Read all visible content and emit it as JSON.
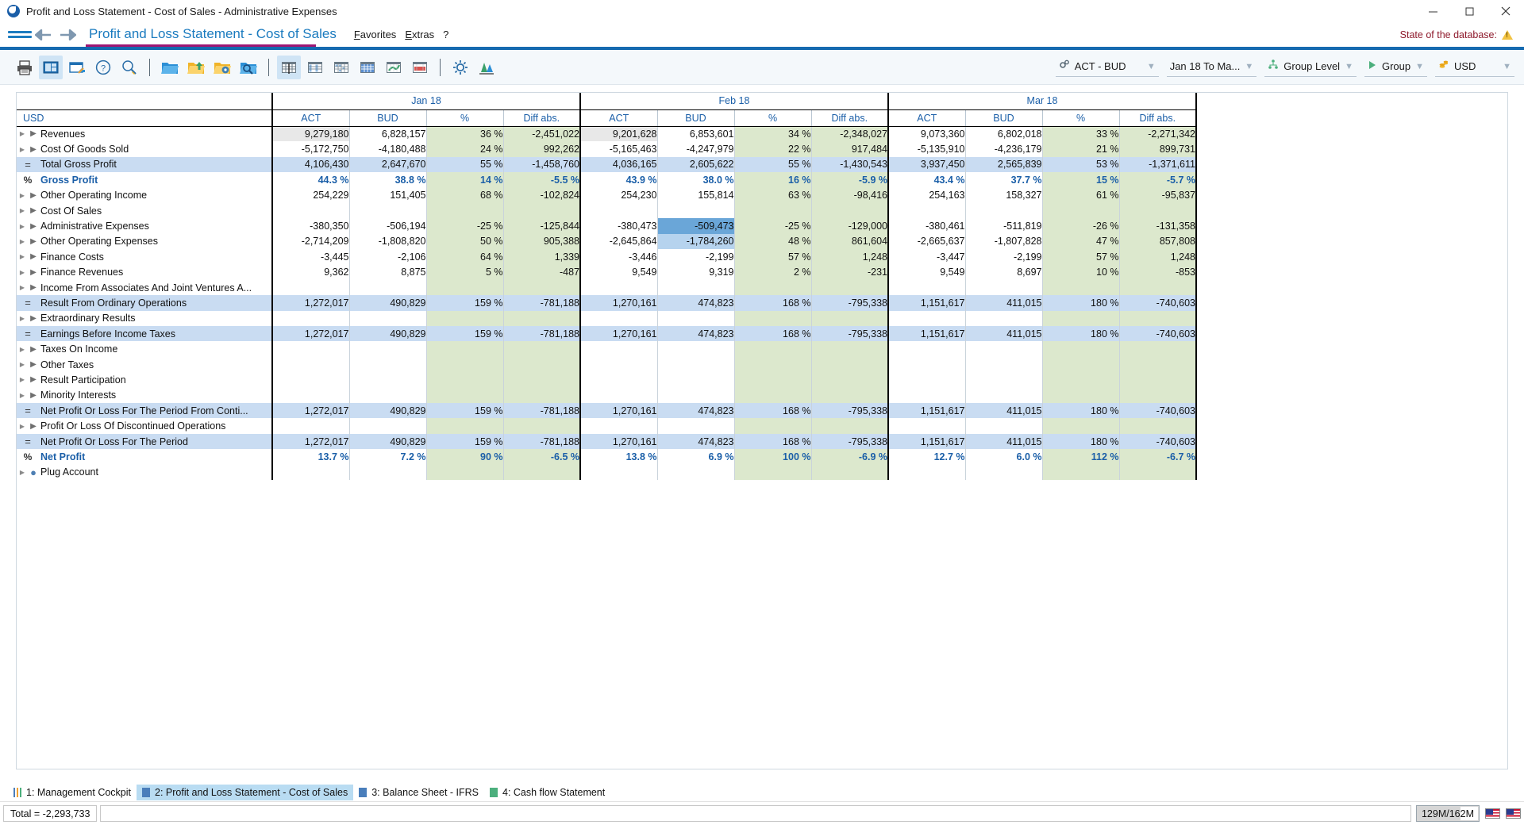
{
  "window": {
    "title": "Profit and Loss Statement - Cost of Sales - Administrative Expenses",
    "minimize_label": "minimize",
    "maximize_label": "maximize",
    "close_label": "close"
  },
  "menubar": {
    "nav_title": "Profit and Loss Statement - Cost of Sales",
    "links": [
      "Favorites",
      "Extras",
      "?"
    ],
    "db_state_label": "State of the database:"
  },
  "toolbar": {
    "icons": [
      {
        "name": "print-icon",
        "title": "Print"
      },
      {
        "name": "layout-panel-icon",
        "title": "Layout"
      },
      {
        "name": "export-icon",
        "title": "Export"
      },
      {
        "name": "help-icon",
        "title": "Help"
      },
      {
        "name": "search-icon",
        "title": "Search"
      },
      {
        "name": "open-folder-icon",
        "title": "Open"
      },
      {
        "name": "folder-upload-icon",
        "title": "Upload"
      },
      {
        "name": "folder-settings-icon",
        "title": "Settings"
      },
      {
        "name": "folder-search-icon",
        "title": "Find report"
      },
      {
        "name": "table-view-icon",
        "title": "Table view"
      },
      {
        "name": "table-columns-icon",
        "title": "Columns"
      },
      {
        "name": "table-grid-icon",
        "title": "Grid"
      },
      {
        "name": "table-dense-icon",
        "title": "Dense grid"
      },
      {
        "name": "table-chart-green-icon",
        "title": "Chart green"
      },
      {
        "name": "table-chart-red-icon",
        "title": "Chart red"
      },
      {
        "name": "gear-icon",
        "title": "Options"
      },
      {
        "name": "compare-icon",
        "title": "Compare"
      }
    ],
    "dropdowns": [
      {
        "name": "dropdown-scenario",
        "icon": "gears-icon",
        "value": "ACT - BUD"
      },
      {
        "name": "dropdown-period",
        "icon": "",
        "value": "Jan 18 To Ma..."
      },
      {
        "name": "dropdown-group-level",
        "icon": "hierarchy-icon",
        "value": "Group Level"
      },
      {
        "name": "dropdown-group",
        "icon": "play-icon",
        "value": "Group"
      },
      {
        "name": "dropdown-currency",
        "icon": "coins-icon",
        "value": "USD"
      }
    ]
  },
  "grid": {
    "currency_header": "USD",
    "period_groups": [
      "Jan 18",
      "Feb 18",
      "Mar 18"
    ],
    "measure_headers": [
      "ACT",
      "BUD",
      "%",
      "Diff abs."
    ],
    "rows": [
      {
        "marker": "expand",
        "label": "Revenues",
        "values": [
          "9,279,180",
          "6,828,157",
          "36 %",
          "-2,451,022",
          "9,201,628",
          "6,853,601",
          "34 %",
          "-2,348,027",
          "9,073,360",
          "6,802,018",
          "33 %",
          "-2,271,342"
        ],
        "style": "normal",
        "act_tint": [
          0,
          4
        ]
      },
      {
        "marker": "expand",
        "label": "Cost Of Goods Sold",
        "values": [
          "-5,172,750",
          "-4,180,488",
          "24 %",
          "992,262",
          "-5,165,463",
          "-4,247,979",
          "22 %",
          "917,484",
          "-5,135,910",
          "-4,236,179",
          "21 %",
          "899,731"
        ],
        "style": "normal"
      },
      {
        "marker": "equals",
        "label": "Total Gross Profit",
        "values": [
          "4,106,430",
          "2,647,670",
          "55 %",
          "-1,458,760",
          "4,036,165",
          "2,605,622",
          "55 %",
          "-1,430,543",
          "3,937,450",
          "2,565,839",
          "53 %",
          "-1,371,611"
        ],
        "style": "sub"
      },
      {
        "marker": "percent",
        "label": "Gross Profit",
        "values": [
          "44.3 %",
          "38.8 %",
          "14 %",
          "-5.5 %",
          "43.9 %",
          "38.0 %",
          "16 %",
          "-5.9 %",
          "43.4 %",
          "37.7 %",
          "15 %",
          "-5.7 %"
        ],
        "style": "pct"
      },
      {
        "marker": "expand",
        "label": "Other Operating Income",
        "values": [
          "254,229",
          "151,405",
          "68 %",
          "-102,824",
          "254,230",
          "155,814",
          "63 %",
          "-98,416",
          "254,163",
          "158,327",
          "61 %",
          "-95,837"
        ],
        "style": "normal"
      },
      {
        "marker": "expand",
        "label": "Cost Of Sales",
        "values": [
          "",
          "",
          "",
          "",
          "",
          "",
          "",
          "",
          "",
          "",
          "",
          ""
        ],
        "style": "normal"
      },
      {
        "marker": "expand",
        "label": "Administrative Expenses",
        "values": [
          "-380,350",
          "-506,194",
          "-25 %",
          "-125,844",
          "-380,473",
          "-509,473",
          "-25 %",
          "-129,000",
          "-380,461",
          "-511,819",
          "-26 %",
          "-131,358"
        ],
        "style": "normal",
        "sel_dark": [
          5
        ]
      },
      {
        "marker": "expand",
        "label": "Other Operating Expenses",
        "values": [
          "-2,714,209",
          "-1,808,820",
          "50 %",
          "905,388",
          "-2,645,864",
          "-1,784,260",
          "48 %",
          "861,604",
          "-2,665,637",
          "-1,807,828",
          "47 %",
          "857,808"
        ],
        "style": "normal",
        "sel_light": [
          5
        ]
      },
      {
        "marker": "expand",
        "label": "Finance Costs",
        "values": [
          "-3,445",
          "-2,106",
          "64 %",
          "1,339",
          "-3,446",
          "-2,199",
          "57 %",
          "1,248",
          "-3,447",
          "-2,199",
          "57 %",
          "1,248"
        ],
        "style": "normal"
      },
      {
        "marker": "expand",
        "label": "Finance Revenues",
        "values": [
          "9,362",
          "8,875",
          "5 %",
          "-487",
          "9,549",
          "9,319",
          "2 %",
          "-231",
          "9,549",
          "8,697",
          "10 %",
          "-853"
        ],
        "style": "normal"
      },
      {
        "marker": "expand",
        "label": "Income From Associates And Joint Ventures A...",
        "values": [
          "",
          "",
          "",
          "",
          "",
          "",
          "",
          "",
          "",
          "",
          "",
          ""
        ],
        "style": "normal"
      },
      {
        "marker": "equals",
        "label": "Result From Ordinary Operations",
        "values": [
          "1,272,017",
          "490,829",
          "159 %",
          "-781,188",
          "1,270,161",
          "474,823",
          "168 %",
          "-795,338",
          "1,151,617",
          "411,015",
          "180 %",
          "-740,603"
        ],
        "style": "sub"
      },
      {
        "marker": "expand",
        "label": "Extraordinary Results",
        "values": [
          "",
          "",
          "",
          "",
          "",
          "",
          "",
          "",
          "",
          "",
          "",
          ""
        ],
        "style": "normal"
      },
      {
        "marker": "equals",
        "label": "Earnings Before Income Taxes",
        "values": [
          "1,272,017",
          "490,829",
          "159 %",
          "-781,188",
          "1,270,161",
          "474,823",
          "168 %",
          "-795,338",
          "1,151,617",
          "411,015",
          "180 %",
          "-740,603"
        ],
        "style": "sub"
      },
      {
        "marker": "expand",
        "label": "Taxes On Income",
        "values": [
          "",
          "",
          "",
          "",
          "",
          "",
          "",
          "",
          "",
          "",
          "",
          ""
        ],
        "style": "normal"
      },
      {
        "marker": "expand",
        "label": "Other Taxes",
        "values": [
          "",
          "",
          "",
          "",
          "",
          "",
          "",
          "",
          "",
          "",
          "",
          ""
        ],
        "style": "normal"
      },
      {
        "marker": "expand",
        "label": "Result Participation",
        "values": [
          "",
          "",
          "",
          "",
          "",
          "",
          "",
          "",
          "",
          "",
          "",
          ""
        ],
        "style": "normal"
      },
      {
        "marker": "expand",
        "label": "Minority Interests",
        "values": [
          "",
          "",
          "",
          "",
          "",
          "",
          "",
          "",
          "",
          "",
          "",
          ""
        ],
        "style": "normal"
      },
      {
        "marker": "equals",
        "label": "Net Profit Or Loss For The Period From Conti...",
        "values": [
          "1,272,017",
          "490,829",
          "159 %",
          "-781,188",
          "1,270,161",
          "474,823",
          "168 %",
          "-795,338",
          "1,151,617",
          "411,015",
          "180 %",
          "-740,603"
        ],
        "style": "sub"
      },
      {
        "marker": "expand",
        "label": "Profit Or Loss Of Discontinued Operations",
        "values": [
          "",
          "",
          "",
          "",
          "",
          "",
          "",
          "",
          "",
          "",
          "",
          ""
        ],
        "style": "normal"
      },
      {
        "marker": "equals",
        "label": "Net Profit Or Loss For The Period",
        "values": [
          "1,272,017",
          "490,829",
          "159 %",
          "-781,188",
          "1,270,161",
          "474,823",
          "168 %",
          "-795,338",
          "1,151,617",
          "411,015",
          "180 %",
          "-740,603"
        ],
        "style": "sub"
      },
      {
        "marker": "percent",
        "label": "Net Profit",
        "values": [
          "13.7 %",
          "7.2 %",
          "90 %",
          "-6.5 %",
          "13.8 %",
          "6.9 %",
          "100 %",
          "-6.9 %",
          "12.7 %",
          "6.0 %",
          "112 %",
          "-6.7 %"
        ],
        "style": "pct"
      },
      {
        "marker": "dot",
        "label": "Plug Account",
        "values": [
          "",
          "",
          "",
          "",
          "",
          "",
          "",
          "",
          "",
          "",
          "",
          ""
        ],
        "style": "normal"
      }
    ]
  },
  "tabs": [
    {
      "label": "1: Management Cockpit",
      "icon": "chart-icon",
      "active": false
    },
    {
      "label": "2: Profit and Loss Statement - Cost of Sales",
      "icon": "blue-square-icon",
      "active": true
    },
    {
      "label": "3: Balance Sheet - IFRS",
      "icon": "blue-square-icon",
      "active": false
    },
    {
      "label": "4: Cash flow Statement",
      "icon": "green-square-icon",
      "active": false
    }
  ],
  "status": {
    "total_label": "Total = -2,293,733",
    "input_value": "",
    "memory": "129M/162M",
    "flags": [
      "us-flag-icon",
      "us-flag-icon"
    ]
  },
  "colors": {
    "accent_blue": "#156ab0",
    "accent_magenta": "#9e1673",
    "link_blue": "#1b7bbf",
    "subtotal_blue": "#c9dcf2",
    "tint_green": "#dce8cd",
    "selection_dark": "#6aa6d8",
    "selection_light": "#b6d3ee",
    "db_state_red": "#8e1a2c"
  }
}
